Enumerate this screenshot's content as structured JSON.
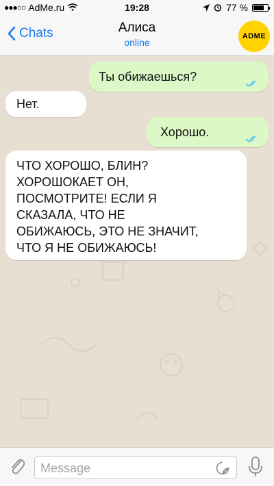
{
  "status_bar": {
    "carrier": "AdMe.ru",
    "time": "19:28",
    "battery_text": "77 %",
    "battery_level": 0.77
  },
  "header": {
    "back_label": "Chats",
    "contact_name": "Алиса",
    "contact_status": "online",
    "avatar_text": "ADME"
  },
  "messages": [
    {
      "direction": "out",
      "text": "Ты обижаешься?",
      "status": "read"
    },
    {
      "direction": "in",
      "text": "Нет."
    },
    {
      "direction": "out",
      "text": "Хорошо.",
      "status": "read"
    },
    {
      "direction": "in",
      "lines": [
        "ЧТО ХОРОШО, БЛИН?",
        "ХОРОШОКАЕТ ОН,",
        "ПОСМОТРИТЕ! ЕСЛИ Я",
        "СКАЗАЛА, ЧТО НЕ",
        "ОБИЖАЮСЬ, ЭТО НЕ ЗНАЧИТ,",
        "ЧТО Я НЕ ОБИЖАЮСЬ!"
      ]
    }
  ],
  "input": {
    "placeholder": "Message"
  },
  "colors": {
    "accent": "#1a7cf2",
    "bubble_out": "#dcf8c6",
    "bubble_in": "#ffffff",
    "chat_background": "#e6dfd2",
    "read_ticks": "#4fc3f7"
  }
}
